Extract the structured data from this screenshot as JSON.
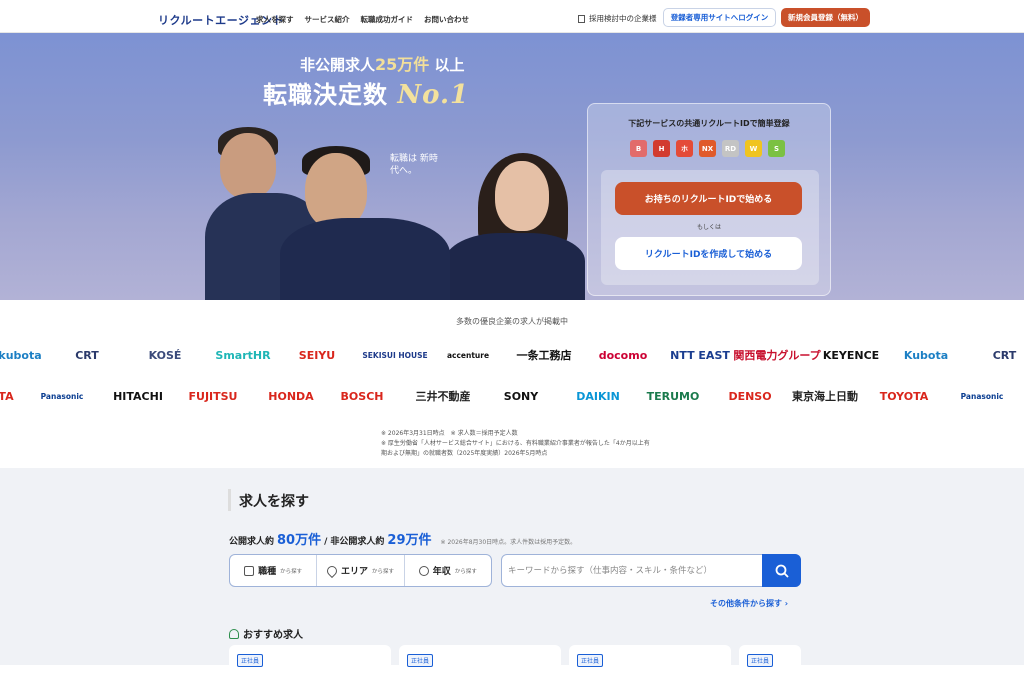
{
  "header": {
    "logo": "リクルートエージェント",
    "nav": [
      "求人を探す",
      "サービス紹介",
      "転職成功ガイド",
      "お問い合わせ"
    ],
    "corp_link": "採用検討中の企業様",
    "login_button": "登録者専用サイトへログイン",
    "register_button": "新規会員登録（無料）"
  },
  "hero": {
    "headline1_pre": "非公開求人",
    "headline1_num": "25万件",
    "headline1_post": "以上",
    "headline2_pre": "転職決定数",
    "headline2_badge": "No.1",
    "tagline": "転職は 新時代へ。",
    "panel_title": "下記サービスの共通リクルートIDで簡単登録",
    "services": [
      {
        "name": "B",
        "color": "#e26b6b"
      },
      {
        "name": "H",
        "color": "#d23b2f"
      },
      {
        "name": "ホ",
        "color": "#e44b38"
      },
      {
        "name": "NX",
        "color": "#e05a2a"
      },
      {
        "name": "RD",
        "color": "#c4c4c4"
      },
      {
        "name": "W",
        "color": "#f0c420"
      },
      {
        "name": "S",
        "color": "#7bc142"
      }
    ],
    "start_button": "お持ちのリクルートIDで始める",
    "or_text": "もしくは",
    "create_button": "リクルートIDを作成して始める"
  },
  "companies": {
    "title": "多数の優良企業の求人が掲載中",
    "row1": [
      {
        "name": "kubota",
        "color": "#1c7fc4"
      },
      {
        "name": "CRT",
        "color": "#2b3a6b"
      },
      {
        "name": "KOSÉ",
        "color": "#3a4a7a"
      },
      {
        "name": "SmartHR",
        "color": "#1fb6b6"
      },
      {
        "name": "SEIYU",
        "color": "#d9261c"
      },
      {
        "name": "SEKISUI HOUSE",
        "color": "#1d3a8a"
      },
      {
        "name": "accenture",
        "color": "#111"
      },
      {
        "name": "一条工務店",
        "color": "#111"
      },
      {
        "name": "docomo",
        "color": "#cc0033"
      },
      {
        "name": "NTT EAST",
        "color": "#1a3d8f"
      },
      {
        "name": "関西電力グループ",
        "color": "#c8102e"
      },
      {
        "name": "KEYENCE",
        "color": "#111"
      },
      {
        "name": "Kubota",
        "color": "#1c7fc4"
      },
      {
        "name": "CRT",
        "color": "#2b3a6b"
      }
    ],
    "row2": [
      {
        "name": "TA",
        "color": "#d9261c"
      },
      {
        "name": "Panasonic",
        "color": "#0a3d91"
      },
      {
        "name": "HITACHI",
        "color": "#111"
      },
      {
        "name": "FUJITSU",
        "color": "#d9261c"
      },
      {
        "name": "HONDA",
        "color": "#d9261c"
      },
      {
        "name": "BOSCH",
        "color": "#d9261c"
      },
      {
        "name": "三井不動産",
        "color": "#222"
      },
      {
        "name": "SONY",
        "color": "#111"
      },
      {
        "name": "DAIKIN",
        "color": "#0a96d6"
      },
      {
        "name": "TERUMO",
        "color": "#1a7a4c"
      },
      {
        "name": "DENSO",
        "color": "#d9261c"
      },
      {
        "name": "東京海上日動",
        "color": "#222"
      },
      {
        "name": "TOYOTA",
        "color": "#d9261c"
      },
      {
        "name": "Panasonic",
        "color": "#0a3d91"
      }
    ],
    "note1": "※ 2026年3月31日時点　※ 求人数＝採用予定人数",
    "note2": "※ 厚生労働省「人材サービス総合サイト」における、有料職業紹介事業者が報告した「4か月以上有期および無期」の就職者数（2025年度実績）2026年5月時点"
  },
  "search": {
    "title": "求人を探す",
    "public_label": "公開求人約",
    "public_count": "80万件",
    "separator": "/",
    "private_label": "非公開求人約",
    "private_count": "29万件",
    "count_note": "※ 2026年8月30日時点。求人件数は採用予定数。",
    "filters": [
      {
        "label": "職種",
        "sub": "から探す"
      },
      {
        "label": "エリア",
        "sub": "から探す"
      },
      {
        "label": "年収",
        "sub": "から探す"
      }
    ],
    "keyword_placeholder": "キーワードから探す（仕事内容・スキル・条件など）",
    "more_link": "その他条件から探す",
    "recommended_title": "おすすめ求人",
    "card_tag": "正社員"
  }
}
